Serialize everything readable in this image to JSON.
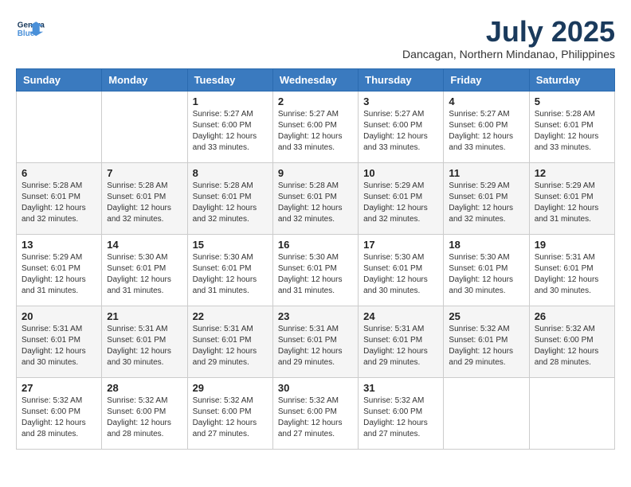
{
  "logo": {
    "line1": "General",
    "line2": "Blue"
  },
  "header": {
    "month_year": "July 2025",
    "location": "Dancagan, Northern Mindanao, Philippines"
  },
  "days_of_week": [
    "Sunday",
    "Monday",
    "Tuesday",
    "Wednesday",
    "Thursday",
    "Friday",
    "Saturday"
  ],
  "weeks": [
    [
      {
        "day": "",
        "info": ""
      },
      {
        "day": "",
        "info": ""
      },
      {
        "day": "1",
        "sunrise": "5:27 AM",
        "sunset": "6:00 PM",
        "daylight": "12 hours and 33 minutes."
      },
      {
        "day": "2",
        "sunrise": "5:27 AM",
        "sunset": "6:00 PM",
        "daylight": "12 hours and 33 minutes."
      },
      {
        "day": "3",
        "sunrise": "5:27 AM",
        "sunset": "6:00 PM",
        "daylight": "12 hours and 33 minutes."
      },
      {
        "day": "4",
        "sunrise": "5:27 AM",
        "sunset": "6:00 PM",
        "daylight": "12 hours and 33 minutes."
      },
      {
        "day": "5",
        "sunrise": "5:28 AM",
        "sunset": "6:01 PM",
        "daylight": "12 hours and 33 minutes."
      }
    ],
    [
      {
        "day": "6",
        "sunrise": "5:28 AM",
        "sunset": "6:01 PM",
        "daylight": "12 hours and 32 minutes."
      },
      {
        "day": "7",
        "sunrise": "5:28 AM",
        "sunset": "6:01 PM",
        "daylight": "12 hours and 32 minutes."
      },
      {
        "day": "8",
        "sunrise": "5:28 AM",
        "sunset": "6:01 PM",
        "daylight": "12 hours and 32 minutes."
      },
      {
        "day": "9",
        "sunrise": "5:28 AM",
        "sunset": "6:01 PM",
        "daylight": "12 hours and 32 minutes."
      },
      {
        "day": "10",
        "sunrise": "5:29 AM",
        "sunset": "6:01 PM",
        "daylight": "12 hours and 32 minutes."
      },
      {
        "day": "11",
        "sunrise": "5:29 AM",
        "sunset": "6:01 PM",
        "daylight": "12 hours and 32 minutes."
      },
      {
        "day": "12",
        "sunrise": "5:29 AM",
        "sunset": "6:01 PM",
        "daylight": "12 hours and 31 minutes."
      }
    ],
    [
      {
        "day": "13",
        "sunrise": "5:29 AM",
        "sunset": "6:01 PM",
        "daylight": "12 hours and 31 minutes."
      },
      {
        "day": "14",
        "sunrise": "5:30 AM",
        "sunset": "6:01 PM",
        "daylight": "12 hours and 31 minutes."
      },
      {
        "day": "15",
        "sunrise": "5:30 AM",
        "sunset": "6:01 PM",
        "daylight": "12 hours and 31 minutes."
      },
      {
        "day": "16",
        "sunrise": "5:30 AM",
        "sunset": "6:01 PM",
        "daylight": "12 hours and 31 minutes."
      },
      {
        "day": "17",
        "sunrise": "5:30 AM",
        "sunset": "6:01 PM",
        "daylight": "12 hours and 30 minutes."
      },
      {
        "day": "18",
        "sunrise": "5:30 AM",
        "sunset": "6:01 PM",
        "daylight": "12 hours and 30 minutes."
      },
      {
        "day": "19",
        "sunrise": "5:31 AM",
        "sunset": "6:01 PM",
        "daylight": "12 hours and 30 minutes."
      }
    ],
    [
      {
        "day": "20",
        "sunrise": "5:31 AM",
        "sunset": "6:01 PM",
        "daylight": "12 hours and 30 minutes."
      },
      {
        "day": "21",
        "sunrise": "5:31 AM",
        "sunset": "6:01 PM",
        "daylight": "12 hours and 30 minutes."
      },
      {
        "day": "22",
        "sunrise": "5:31 AM",
        "sunset": "6:01 PM",
        "daylight": "12 hours and 29 minutes."
      },
      {
        "day": "23",
        "sunrise": "5:31 AM",
        "sunset": "6:01 PM",
        "daylight": "12 hours and 29 minutes."
      },
      {
        "day": "24",
        "sunrise": "5:31 AM",
        "sunset": "6:01 PM",
        "daylight": "12 hours and 29 minutes."
      },
      {
        "day": "25",
        "sunrise": "5:32 AM",
        "sunset": "6:01 PM",
        "daylight": "12 hours and 29 minutes."
      },
      {
        "day": "26",
        "sunrise": "5:32 AM",
        "sunset": "6:00 PM",
        "daylight": "12 hours and 28 minutes."
      }
    ],
    [
      {
        "day": "27",
        "sunrise": "5:32 AM",
        "sunset": "6:00 PM",
        "daylight": "12 hours and 28 minutes."
      },
      {
        "day": "28",
        "sunrise": "5:32 AM",
        "sunset": "6:00 PM",
        "daylight": "12 hours and 28 minutes."
      },
      {
        "day": "29",
        "sunrise": "5:32 AM",
        "sunset": "6:00 PM",
        "daylight": "12 hours and 27 minutes."
      },
      {
        "day": "30",
        "sunrise": "5:32 AM",
        "sunset": "6:00 PM",
        "daylight": "12 hours and 27 minutes."
      },
      {
        "day": "31",
        "sunrise": "5:32 AM",
        "sunset": "6:00 PM",
        "daylight": "12 hours and 27 minutes."
      },
      {
        "day": "",
        "info": ""
      },
      {
        "day": "",
        "info": ""
      }
    ]
  ]
}
